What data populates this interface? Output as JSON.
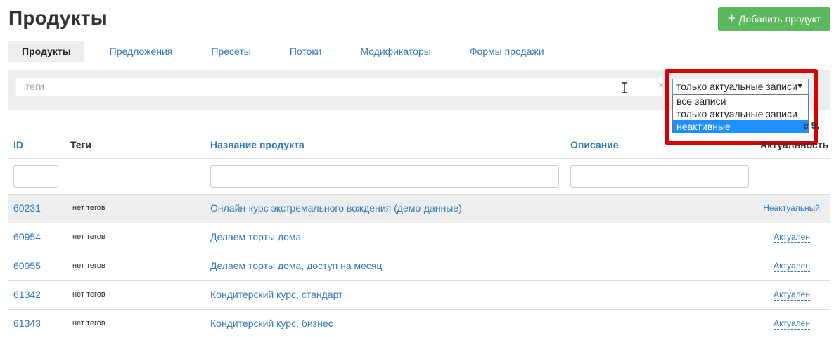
{
  "page": {
    "title": "Продукты"
  },
  "actions": {
    "add_product_label": "Добавить продукт",
    "add_icon": "plus-icon"
  },
  "tabs": [
    {
      "label": "Продукты",
      "active": true
    },
    {
      "label": "Предложения"
    },
    {
      "label": "Пресеты"
    },
    {
      "label": "Потоки"
    },
    {
      "label": "Модификаторы"
    },
    {
      "label": "Формы продажи"
    }
  ],
  "filter": {
    "tags_placeholder": "теги",
    "clear_glyph": "×",
    "status_select": {
      "value": "только актуальные записи",
      "arrow": "▼",
      "options": [
        "все записи",
        "только актуальные записи",
        "неактивные"
      ],
      "hovered_option": "неактивные"
    }
  },
  "summary": {
    "count_text": "е 9."
  },
  "table": {
    "headers": {
      "id": "ID",
      "tags": "Теги",
      "name": "Название продукта",
      "description": "Описание",
      "status": "Актуальность"
    },
    "rows": [
      {
        "id": "60231",
        "tags": "нет тегов",
        "name": "Онлайн-курс экстремального вождения (демо-данные)",
        "status": "Неактуальный"
      },
      {
        "id": "60954",
        "tags": "нет тегов",
        "name": "Делаем торты дома",
        "status": "Актуален"
      },
      {
        "id": "60955",
        "tags": "нет тегов",
        "name": "Делаем торты дома, доступ на месяц",
        "status": "Актуален"
      },
      {
        "id": "61342",
        "tags": "нет тегов",
        "name": "Кондитерский курс, стандарт",
        "status": "Актуален"
      },
      {
        "id": "61343",
        "tags": "нет тегов",
        "name": "Кондитерский курс, бизнес",
        "status": "Актуален"
      }
    ]
  },
  "colors": {
    "accent": "#337ab7",
    "add_button": "#5cb85c",
    "highlight_frame": "#d40000",
    "option_selected": "#1e90ff"
  }
}
